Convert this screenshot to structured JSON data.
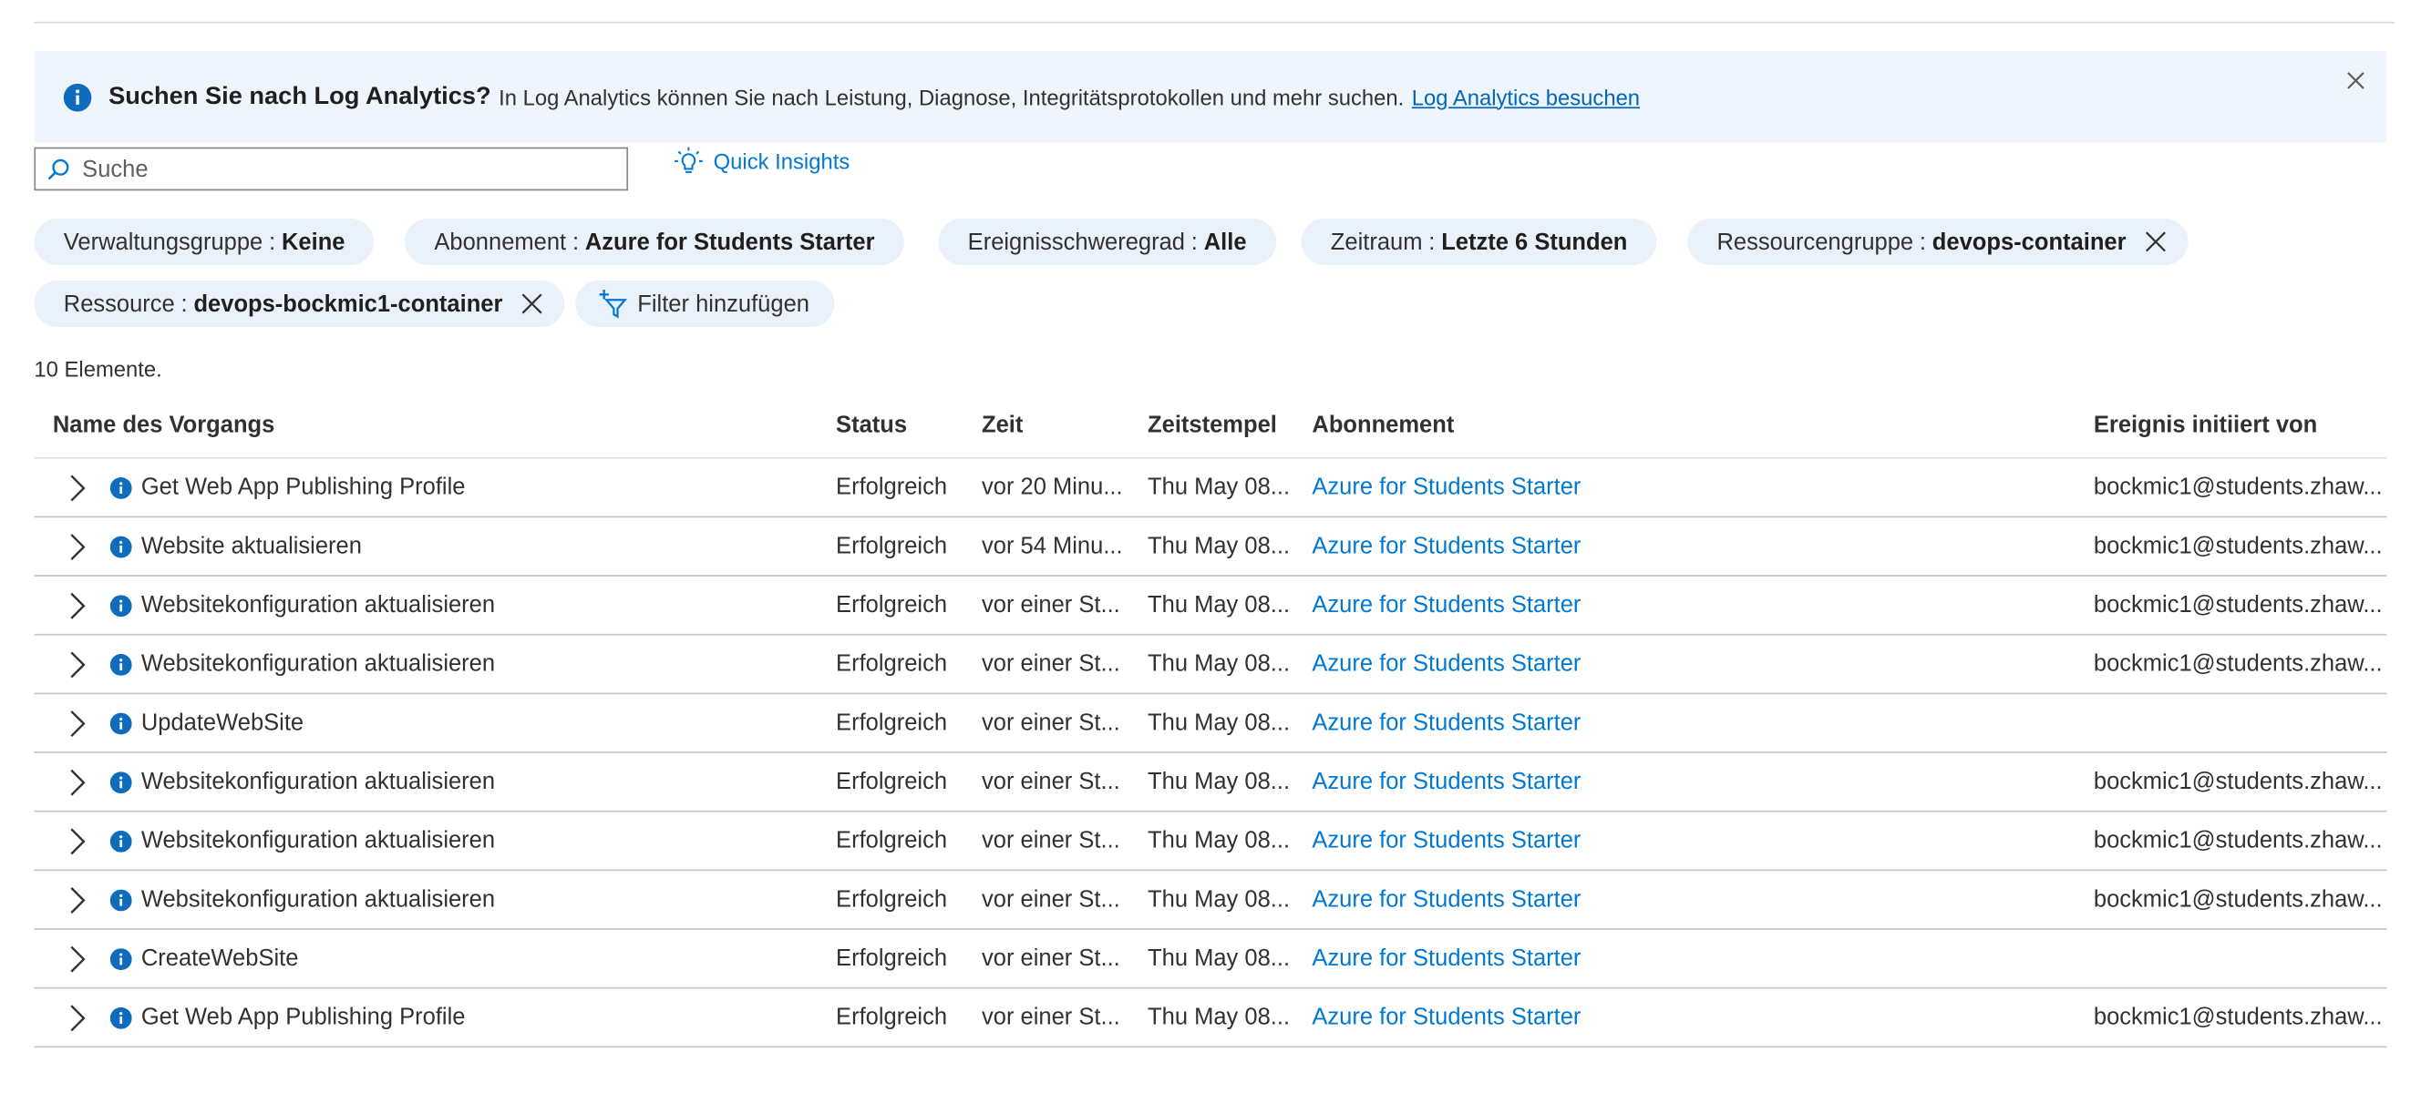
{
  "banner": {
    "title": "Suchen Sie nach Log Analytics?",
    "text": "In Log Analytics können Sie nach Leistung, Diagnose, Integritätsprotokollen und mehr suchen.",
    "link": "Log Analytics besuchen"
  },
  "search": {
    "placeholder": "Suche"
  },
  "quick_insights": "Quick Insights",
  "filters": [
    {
      "key": "Verwaltungsgruppe",
      "value": "Keine",
      "removable": false
    },
    {
      "key": "Abonnement",
      "value": "Azure for Students Starter",
      "removable": false
    },
    {
      "key": "Ereignisschweregrad",
      "value": "Alle",
      "removable": false
    },
    {
      "key": "Zeitraum",
      "value": "Letzte 6 Stunden",
      "removable": false
    },
    {
      "key": "Ressourcengruppe",
      "value": "devops-container",
      "removable": true
    },
    {
      "key": "Ressource",
      "value": "devops-bockmic1-container",
      "removable": true
    }
  ],
  "filter_sep": ":",
  "add_filter": "Filter hinzufügen",
  "count": "10 Elemente.",
  "table": {
    "headers": [
      "Name des Vorgangs",
      "Status",
      "Zeit",
      "Zeitstempel",
      "Abonnement",
      "Ereignis initiiert von"
    ],
    "rows": [
      [
        "Get Web App Publishing Profile",
        "Erfolgreich",
        "vor 20 Minu...",
        "Thu May 08...",
        "Azure for Students Starter",
        "bockmic1@students.zhaw..."
      ],
      [
        "Website aktualisieren",
        "Erfolgreich",
        "vor 54 Minu...",
        "Thu May 08...",
        "Azure for Students Starter",
        "bockmic1@students.zhaw..."
      ],
      [
        "Websitekonfiguration aktualisieren",
        "Erfolgreich",
        "vor einer St...",
        "Thu May 08...",
        "Azure for Students Starter",
        "bockmic1@students.zhaw..."
      ],
      [
        "Websitekonfiguration aktualisieren",
        "Erfolgreich",
        "vor einer St...",
        "Thu May 08...",
        "Azure for Students Starter",
        "bockmic1@students.zhaw..."
      ],
      [
        "UpdateWebSite",
        "Erfolgreich",
        "vor einer St...",
        "Thu May 08...",
        "Azure for Students Starter",
        ""
      ],
      [
        "Websitekonfiguration aktualisieren",
        "Erfolgreich",
        "vor einer St...",
        "Thu May 08...",
        "Azure for Students Starter",
        "bockmic1@students.zhaw..."
      ],
      [
        "Websitekonfiguration aktualisieren",
        "Erfolgreich",
        "vor einer St...",
        "Thu May 08...",
        "Azure for Students Starter",
        "bockmic1@students.zhaw..."
      ],
      [
        "Websitekonfiguration aktualisieren",
        "Erfolgreich",
        "vor einer St...",
        "Thu May 08...",
        "Azure for Students Starter",
        "bockmic1@students.zhaw..."
      ],
      [
        "CreateWebSite",
        "Erfolgreich",
        "vor einer St...",
        "Thu May 08...",
        "Azure for Students Starter",
        ""
      ],
      [
        "Get Web App Publishing Profile",
        "Erfolgreich",
        "vor einer St...",
        "Thu May 08...",
        "Azure for Students Starter",
        "bockmic1@students.zhaw..."
      ]
    ]
  },
  "colors": {
    "accent": "#0078d4",
    "info_icon": "#0f6cbd",
    "banner_bg": "#eef5fd",
    "pill_bg": "#e9f1fb"
  },
  "icons": {
    "banner": "info-icon",
    "close": "close-icon",
    "search": "search-icon",
    "quick_insights": "lightbulb-icon",
    "add_filter": "filter-add-icon",
    "row_expand": "chevron-right-icon",
    "row_level": "info-icon"
  }
}
